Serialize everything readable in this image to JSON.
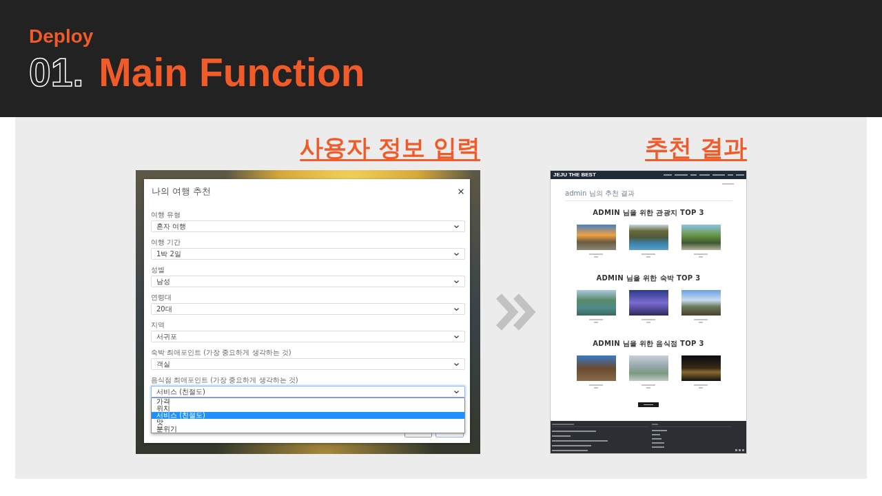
{
  "header": {
    "label": "Deploy",
    "number": "01.",
    "title": "Main Function"
  },
  "input_panel": {
    "heading": "사용자 정보 입력",
    "modal": {
      "title": "나의 여행 추천",
      "fields": [
        {
          "label": "여행 유형",
          "value": "혼자 여행",
          "focused": false
        },
        {
          "label": "여행 기간",
          "value": "1박 2일",
          "focused": false
        },
        {
          "label": "성별",
          "value": "남성",
          "focused": false
        },
        {
          "label": "연령대",
          "value": "20대",
          "focused": false
        },
        {
          "label": "지역",
          "value": "서귀포",
          "focused": false
        },
        {
          "label": "숙박 최애포인트 (가장 중요하게 생각하는 것)",
          "value": "객실",
          "focused": false
        },
        {
          "label": "음식점 최애포인트 (가장 중요하게 생각하는 것)",
          "value": "서비스 (친절도)",
          "focused": true,
          "options": [
            {
              "label": "가격",
              "selected": false
            },
            {
              "label": "위치",
              "selected": false
            },
            {
              "label": "서비스 (친절도)",
              "selected": true
            },
            {
              "label": "맛",
              "selected": false
            },
            {
              "label": "분위기",
              "selected": false
            }
          ]
        }
      ]
    }
  },
  "result_panel": {
    "heading": "추천 결과",
    "site": {
      "brand": "JEJU THE BEST",
      "page_title": "admin 님의 추천 결과",
      "sections": [
        {
          "title": "ADMIN 님을 위한 관광지 TOP 3"
        },
        {
          "title": "ADMIN 님을 위한 숙박 TOP 3"
        },
        {
          "title": "ADMIN 님을 위한 음식점 TOP 3"
        }
      ]
    }
  }
}
